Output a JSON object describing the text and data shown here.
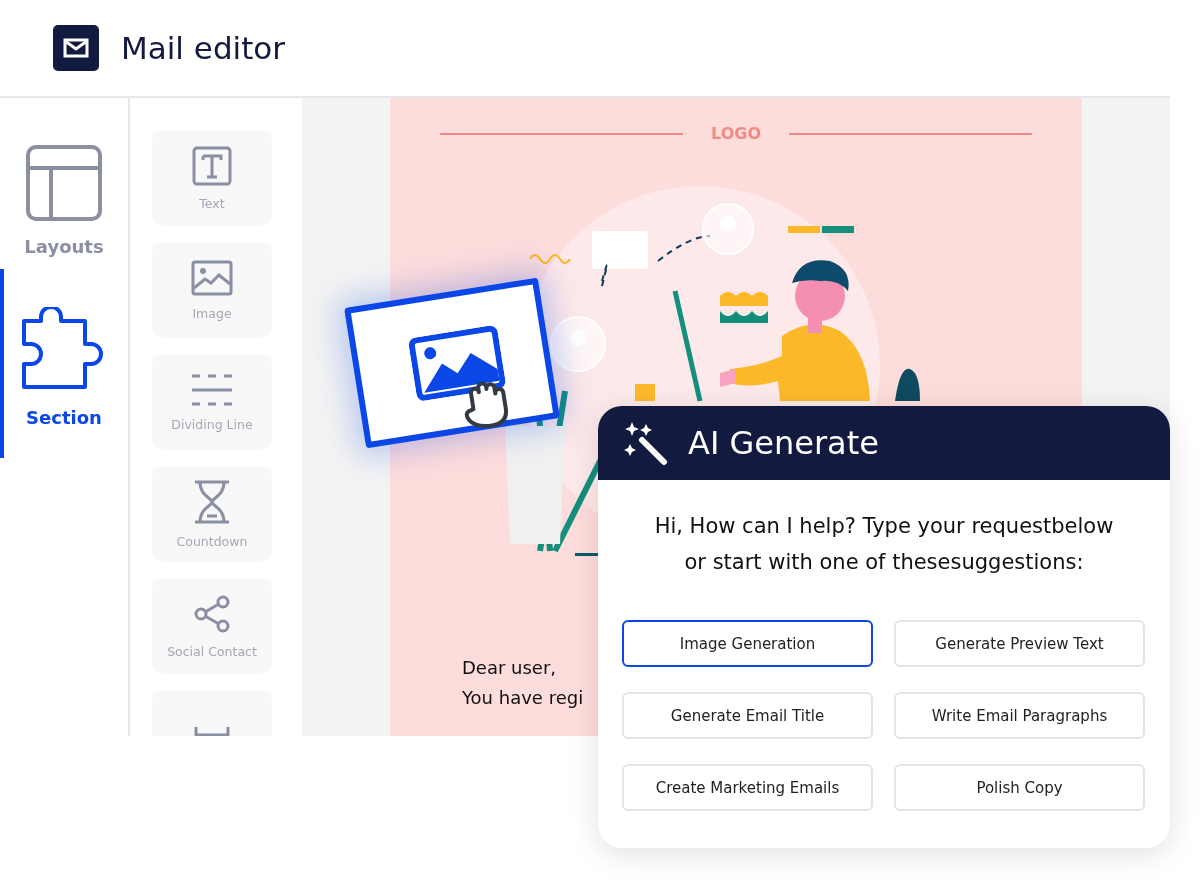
{
  "window": {
    "title": "Mail editor"
  },
  "nav_items": [
    {
      "label": "Layouts",
      "kind": "layouts",
      "selected": false
    },
    {
      "label": "Section",
      "kind": "section",
      "selected": true
    }
  ],
  "elements": [
    {
      "label": "Text",
      "kind": "text"
    },
    {
      "label": "Image",
      "kind": "image"
    },
    {
      "label": "Dividing Line",
      "kind": "divider"
    },
    {
      "label": "Countdown",
      "kind": "countdown"
    },
    {
      "label": "Social Contact",
      "kind": "social"
    },
    {
      "kind": "spacer"
    }
  ],
  "email": {
    "logo": "LOGO",
    "greeting": "Dear user,",
    "body": "You have regi"
  },
  "ai_panel": {
    "title": "AI Generate",
    "message_lines": [
      "Hi, How can I help? Type your requestbelow",
      "or start with one of thesesuggestions:"
    ],
    "suggestions": [
      {
        "label": "Image Generation",
        "selected": true
      },
      {
        "label": "Generate Preview Text",
        "selected": false
      },
      {
        "label": "Generate Email Title",
        "selected": false
      },
      {
        "label": "Write Email Paragraphs",
        "selected": false
      },
      {
        "label": "Create Marketing Emails",
        "selected": false
      },
      {
        "label": "Polish Copy",
        "selected": false
      }
    ]
  }
}
